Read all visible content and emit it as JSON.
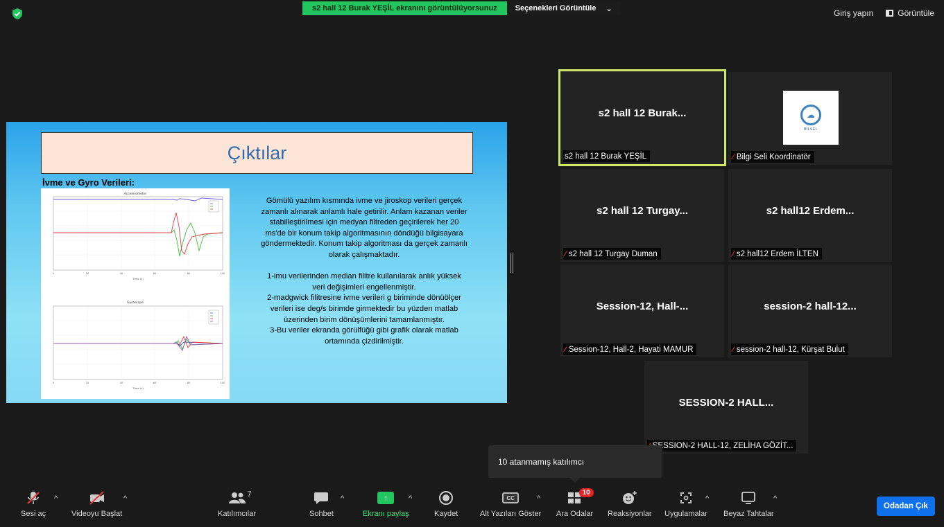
{
  "banner": {
    "sharing_text": "s2 hall 12 Burak YEŞİL ekranını görüntülüyorsunuz",
    "options_label": "Seçenekleri Görüntüle"
  },
  "top_right": {
    "signin_label": "Giriş yapın",
    "view_label": "Görüntüle"
  },
  "slide": {
    "title": "Çıktılar",
    "subtitle": "İvme ve Gyro Verileri:",
    "body": "Gömülü yazılım kısmında ivme ve jiroskop verileri gerçek zamanlı alınarak anlamlı hale getirilir. Anlam kazanan veriler stabilleştirilmesi için medyan filtreden geçirilerek her 20 ms'de bir konum takip algoritmasının döndüğü bilgisayara göndermektedir. Konum takip algoritması da gerçek zamanlı olarak çalışmaktadır.\n\n1-imu verilerinden median filitre kullanılarak anlık yüksek veri değişimleri engellenmiştir.\n2-madgwick filitresine ivme verileri g biriminde dönüölçer verileri ise deg/s birimde girmektedir bu yüzden matlab üzerinden birim dönüşümlerini tamamlanmıştır.\n3-Bu veriler ekranda görülfüğü gibi grafik olarak matlab ortamında çizdirilmiştir.",
    "chart_top_title": "Accelerometer",
    "chart_bottom_title": "Gyroscope",
    "chart_xlabel": "Time (s)",
    "x_ticks": [
      "0",
      "20",
      "40",
      "60",
      "80",
      "100"
    ]
  },
  "tiles": [
    {
      "name": "s2 hall 12 Burak...",
      "label": "s2 hall 12 Burak YEŞİL",
      "muted": false,
      "active": true
    },
    {
      "name": "",
      "label": "Bilgi Seli Koordinatör",
      "muted": true,
      "logo": "BİLSEL"
    },
    {
      "name": "s2 hall 12 Turgay...",
      "label": "s2 hall 12 Turgay Duman",
      "muted": true
    },
    {
      "name": "s2 hall12 Erdem...",
      "label": "s2 hall12 Erdem İLTEN",
      "muted": true
    },
    {
      "name": "Session-12, Hall-...",
      "label": "Session-12, Hall-2, Hayati MAMUR",
      "muted": true
    },
    {
      "name": "session-2 hall-12...",
      "label": "session-2 hall-12, Kürşat Bulut",
      "muted": true
    },
    {
      "name": "SESSION-2 HALL...",
      "label": "SESSION-2 HALL-12, ZELİHA GÖZİT...",
      "muted": true
    }
  ],
  "tooltip": "10 atanmamış katılımcı",
  "toolbar": {
    "audio": "Sesi aç",
    "video": "Videoyu Başlat",
    "participants": "Katılımcılar",
    "participants_count": "7",
    "chat": "Sohbet",
    "share": "Ekranı paylaş",
    "record": "Kaydet",
    "captions": "Alt Yazıları Göster",
    "captions_icon": "CC",
    "breakout": "Ara Odalar",
    "breakout_badge": "10",
    "reactions": "Reaksiyonlar",
    "apps": "Uygulamalar",
    "whiteboard": "Beyaz Tahtalar",
    "leave": "Odadan Çık"
  },
  "colors": {
    "share_green": "#22c55e",
    "active_border": "#cfe86a",
    "leave_blue": "#0e71eb",
    "mute_red": "#e0383e"
  }
}
